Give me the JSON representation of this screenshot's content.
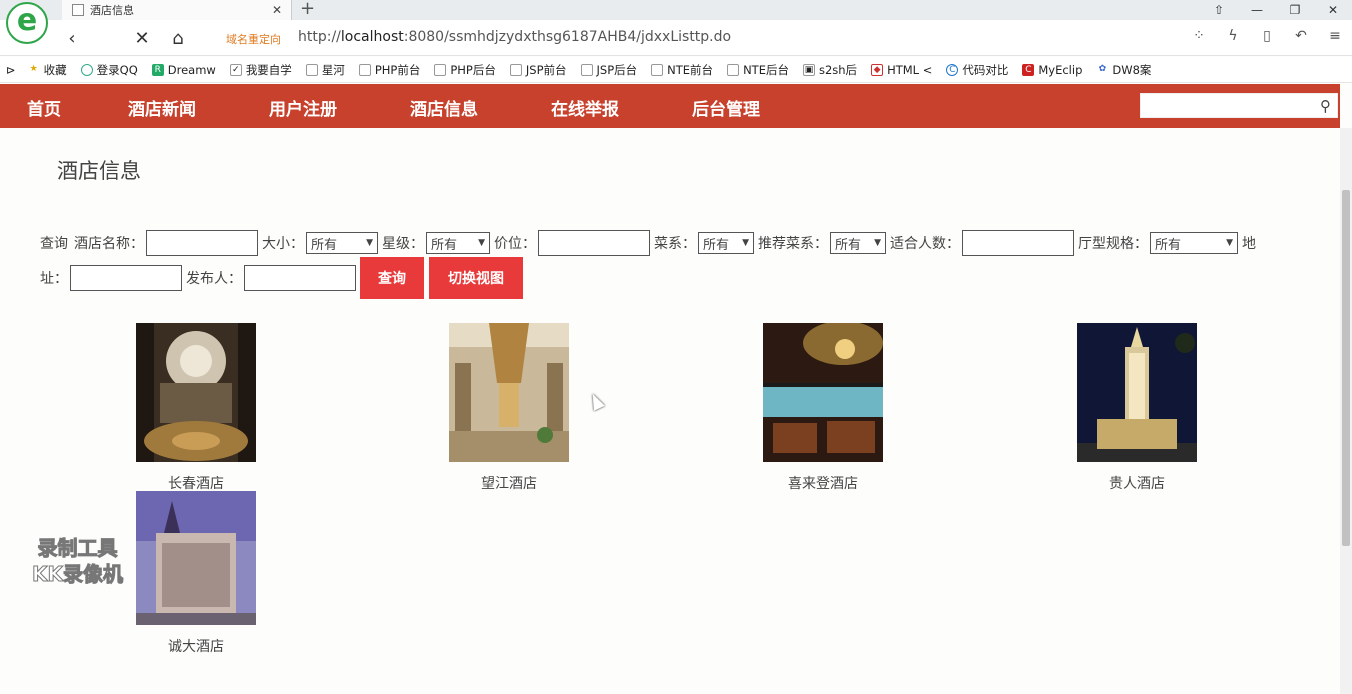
{
  "browser": {
    "tab_title": "酒店信息",
    "tab_close": "✕",
    "new_tab": "+",
    "redirect_label": "域名重定向",
    "url_prefix": "http://",
    "url_host": "localhost",
    "url_rest": ":8080/ssmhdjzydxthsg6187AHB4/jdxxListtp.do",
    "bookmarks": [
      "收藏",
      "登录QQ",
      "Dreamw",
      "我要自学",
      "星河",
      "PHP前台",
      "PHP后台",
      "JSP前台",
      "JSP后台",
      "NTE前台",
      "NTE后台",
      "s2sh后",
      "HTML <",
      "代码对比",
      "MyEclip",
      "DW8案"
    ]
  },
  "site": {
    "nav": [
      "首页",
      "酒店新闻",
      "用户注册",
      "酒店信息",
      "在线举报",
      "后台管理"
    ],
    "search_value": "",
    "page_title": "酒店信息"
  },
  "filters": {
    "query_label": "查询",
    "name_label": "酒店名称：",
    "size_label": "大小：",
    "size_value": "所有",
    "star_label": "星级：",
    "star_value": "所有",
    "price_label": "价位：",
    "cuisine_label": "菜系：",
    "cuisine_value": "所有",
    "recommended_label": "推荐菜系：",
    "recommended_value": "所有",
    "capacity_label": "适合人数：",
    "hall_label": "厅型规格：",
    "hall_value": "所有",
    "address_label_1": "地",
    "address_label_2": "址：",
    "publisher_label": "发布人：",
    "search_button": "查询",
    "switch_view_button": "切换视图"
  },
  "hotels": [
    {
      "name": "长春酒店"
    },
    {
      "name": "望江酒店"
    },
    {
      "name": "喜来登酒店"
    },
    {
      "name": "贵人酒店"
    },
    {
      "name": "诚大酒店"
    }
  ],
  "watermark": {
    "line1": "录制工具",
    "line2": "KK录像机"
  },
  "colors": {
    "nav_bg": "#c7412d",
    "button_red": "#e83a3a"
  }
}
